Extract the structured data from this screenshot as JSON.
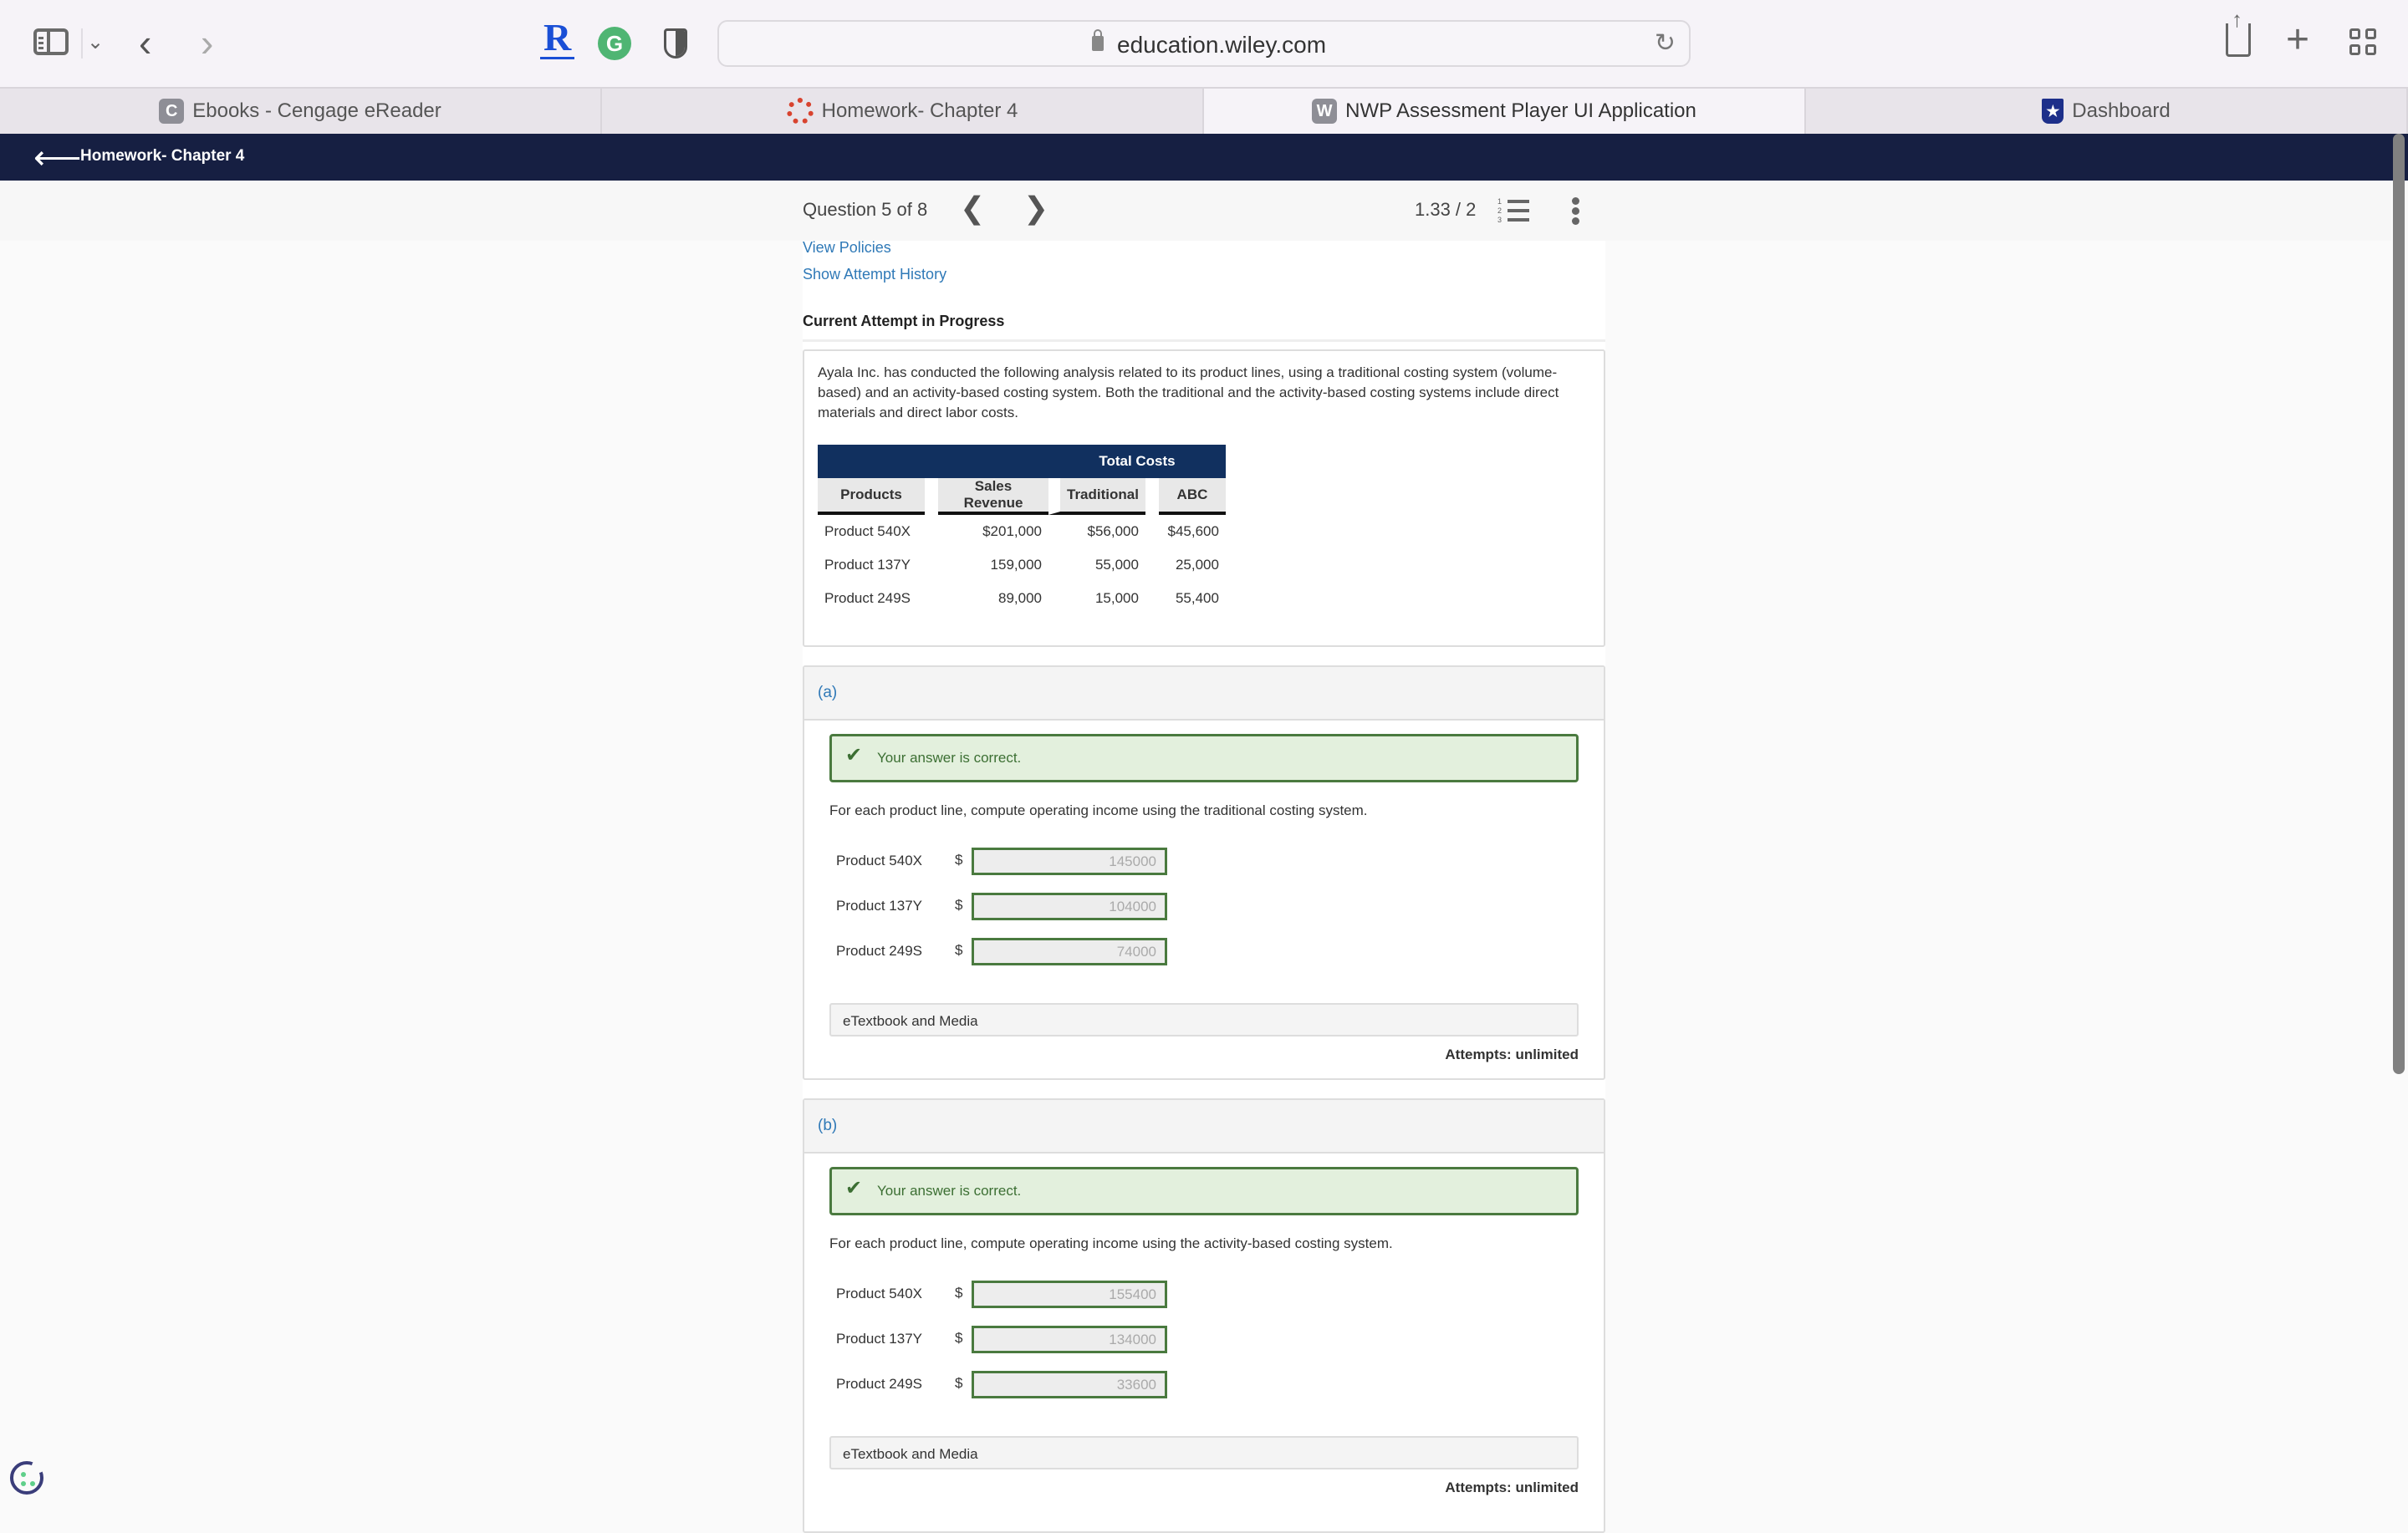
{
  "browser": {
    "url": "education.wiley.com",
    "extensions": [
      {
        "name": "rakuten-extension",
        "glyph": "R"
      },
      {
        "name": "grammarly-extension",
        "glyph": "G"
      },
      {
        "name": "privacy-shield-extension",
        "glyph": ""
      }
    ],
    "tabs": [
      {
        "label": "Ebooks - Cengage eReader",
        "icon": "cengage-c-icon",
        "icon_glyph": "C",
        "active": false
      },
      {
        "label": "Homework- Chapter 4",
        "icon": "canvas-icon",
        "icon_glyph": "",
        "active": false
      },
      {
        "label": "NWP Assessment Player UI Application",
        "icon": "wiley-w-icon",
        "icon_glyph": "W",
        "active": true
      },
      {
        "label": "Dashboard",
        "icon": "dashboard-shield-icon",
        "icon_glyph": "★",
        "active": false
      }
    ]
  },
  "app_header": {
    "title": "Homework- Chapter 4",
    "back_glyph": "⟵"
  },
  "question_nav": {
    "position": "Question 5 of 8",
    "prev_glyph": "❮",
    "next_glyph": "❯",
    "score": "1.33 / 2"
  },
  "links": {
    "view_policies": "View Policies",
    "show_attempt_history": "Show Attempt History"
  },
  "current_attempt": "Current Attempt in Progress",
  "problem": {
    "text": "Ayala Inc. has conducted the following analysis related to its product lines, using a traditional costing system (volume-based) and an activity-based costing system. Both the traditional and the activity-based costing systems include direct materials and direct labor costs.",
    "table": {
      "group_header": "Total Costs",
      "columns": [
        "Products",
        "Sales Revenue",
        "Traditional",
        "ABC"
      ],
      "rows": [
        [
          "Product 540X",
          "$201,000",
          "$56,000",
          "$45,600"
        ],
        [
          "Product 137Y",
          "159,000",
          "55,000",
          "25,000"
        ],
        [
          "Product 249S",
          "89,000",
          "15,000",
          "55,400"
        ]
      ]
    }
  },
  "parts": [
    {
      "label": "(a)",
      "status": "Your answer is correct.",
      "instruction": "For each product line, compute operating income using the traditional costing system.",
      "answers": [
        {
          "product": "Product 540X",
          "currency": "$",
          "value": "145000"
        },
        {
          "product": "Product 137Y",
          "currency": "$",
          "value": "104000"
        },
        {
          "product": "Product 249S",
          "currency": "$",
          "value": "74000"
        }
      ],
      "media": "eTextbook and Media",
      "attempts": "Attempts: unlimited"
    },
    {
      "label": "(b)",
      "status": "Your answer is correct.",
      "instruction": "For each product line, compute operating income using the activity-based costing system.",
      "answers": [
        {
          "product": "Product 540X",
          "currency": "$",
          "value": "155400"
        },
        {
          "product": "Product 137Y",
          "currency": "$",
          "value": "134000"
        },
        {
          "product": "Product 249S",
          "currency": "$",
          "value": "33600"
        }
      ],
      "media": "eTextbook and Media",
      "attempts": "Attempts: unlimited"
    }
  ],
  "colors": {
    "app_header_bg": "#161f42",
    "table_header_bg": "#11305f",
    "link": "#2f79b7",
    "correct_bg": "#e3f0dd",
    "correct_border": "#4a7a3f"
  }
}
